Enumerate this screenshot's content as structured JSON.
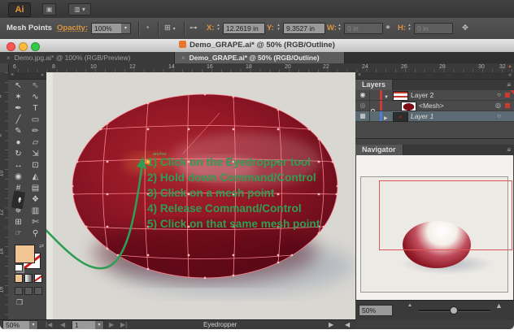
{
  "icons": {
    "caret": "▾",
    "collapse": "«",
    "close": "×",
    "menu": "≡",
    "scroll_up": "▲"
  },
  "app_bar": {
    "logo": "Ai",
    "bridge_icon": "▣",
    "workspace_icon": "▥"
  },
  "control_bar": {
    "selection_label": "Mesh Points",
    "opacity_label": "Opacity:",
    "opacity_value": "100%",
    "recolor_icon": "◔",
    "select_menu_icon": "⊞",
    "isolate_icon": "⊶",
    "x_label": "X:",
    "x_value": "12.2619 in",
    "y_label": "Y:",
    "y_value": "9.3527 in",
    "w_label": "W:",
    "w_value": "0 in",
    "link_icon": "⚭",
    "h_label": "H:",
    "h_value": "0 in",
    "free_transform_icon": "✥",
    "stepper_up": "▲",
    "stepper_down": "▼"
  },
  "window": {
    "title": "Demo_GRAPE.ai* @ 50% (RGB/Outline)"
  },
  "tabs": [
    {
      "label": "Demo.jpg.ai* @ 100% (RGB/Preview)"
    },
    {
      "label": "Demo_GRAPE.ai* @ 50% (RGB/Outline)"
    }
  ],
  "rulers": {
    "h": [
      "6",
      "8",
      "10",
      "12",
      "14",
      "16",
      "18",
      "20",
      "22",
      "24",
      "26",
      "28",
      "30",
      "32"
    ],
    "v": [
      "6",
      "8",
      "10",
      "12",
      "14",
      "16"
    ]
  },
  "toolbar": {
    "tools": [
      {
        "name": "selection-tool",
        "glyph": "↖"
      },
      {
        "name": "direct-selection-tool",
        "glyph": "⇖"
      },
      {
        "name": "magic-wand-tool",
        "glyph": "✶"
      },
      {
        "name": "lasso-tool",
        "glyph": "∿"
      },
      {
        "name": "pen-tool",
        "glyph": "✒"
      },
      {
        "name": "type-tool",
        "glyph": "T"
      },
      {
        "name": "line-segment-tool",
        "glyph": "╱"
      },
      {
        "name": "rectangle-tool",
        "glyph": "▭"
      },
      {
        "name": "paintbrush-tool",
        "glyph": "✎"
      },
      {
        "name": "pencil-tool",
        "glyph": "✏"
      },
      {
        "name": "blob-brush-tool",
        "glyph": "●"
      },
      {
        "name": "eraser-tool",
        "glyph": "▱"
      },
      {
        "name": "rotate-tool",
        "glyph": "↻"
      },
      {
        "name": "scale-tool",
        "glyph": "⇲"
      },
      {
        "name": "width-tool",
        "glyph": "↔"
      },
      {
        "name": "free-transform-tool",
        "glyph": "⊡"
      },
      {
        "name": "shape-builder-tool",
        "glyph": "◉"
      },
      {
        "name": "perspective-grid-tool",
        "glyph": "◭"
      },
      {
        "name": "mesh-tool",
        "glyph": "#"
      },
      {
        "name": "gradient-tool",
        "glyph": "▤"
      },
      {
        "name": "eyedropper-tool",
        "glyph": "✒"
      },
      {
        "name": "blend-tool",
        "glyph": "❖"
      },
      {
        "name": "symbol-sprayer-tool",
        "glyph": "✵"
      },
      {
        "name": "column-graph-tool",
        "glyph": "▥"
      },
      {
        "name": "artboard-tool",
        "glyph": "⊞"
      },
      {
        "name": "slice-tool",
        "glyph": "✄"
      },
      {
        "name": "hand-tool",
        "glyph": "☞"
      },
      {
        "name": "zoom-tool",
        "glyph": "⚲"
      }
    ],
    "swap_icon": "⇄",
    "screen_mode_icon": "❐"
  },
  "canvas": {
    "instructions": [
      "1) Click on the Eyedropper tool",
      "2) Hold down Command/Control",
      "3) Click on a mesh point",
      "4) Release Command/Control",
      "5) Click on that same mesh point"
    ],
    "anchor_label": "anchor"
  },
  "layers": {
    "title": "Layers",
    "rows": [
      {
        "label": "Layer 2",
        "eye": "◉",
        "disc": "▼",
        "target": "○"
      },
      {
        "label": "<Mesh>",
        "eye": "◎",
        "disc": "",
        "target": "◎"
      },
      {
        "label": "Layer 1",
        "eye": "▦",
        "disc": "▶",
        "target": "○"
      }
    ]
  },
  "navigator": {
    "title": "Navigator",
    "zoom": "50%"
  },
  "status": {
    "zoom": "50%",
    "first": "|◀",
    "prev": "◀",
    "artboard": "1",
    "next": "▶",
    "last": "▶|",
    "tool": "Eyedropper",
    "forward": "▶",
    "scroll": "◀"
  },
  "colors": {
    "accent_orange": "#dd9440",
    "mesh_pink": "#ff8a94",
    "note_green": "#2f9e54",
    "grape_dark_red": "#76101f",
    "layer_color_red": "#d23b33",
    "layer_color_blue": "#4a7fd4",
    "fill_swatch": "#f0c493",
    "proxy_red": "#e05555"
  }
}
